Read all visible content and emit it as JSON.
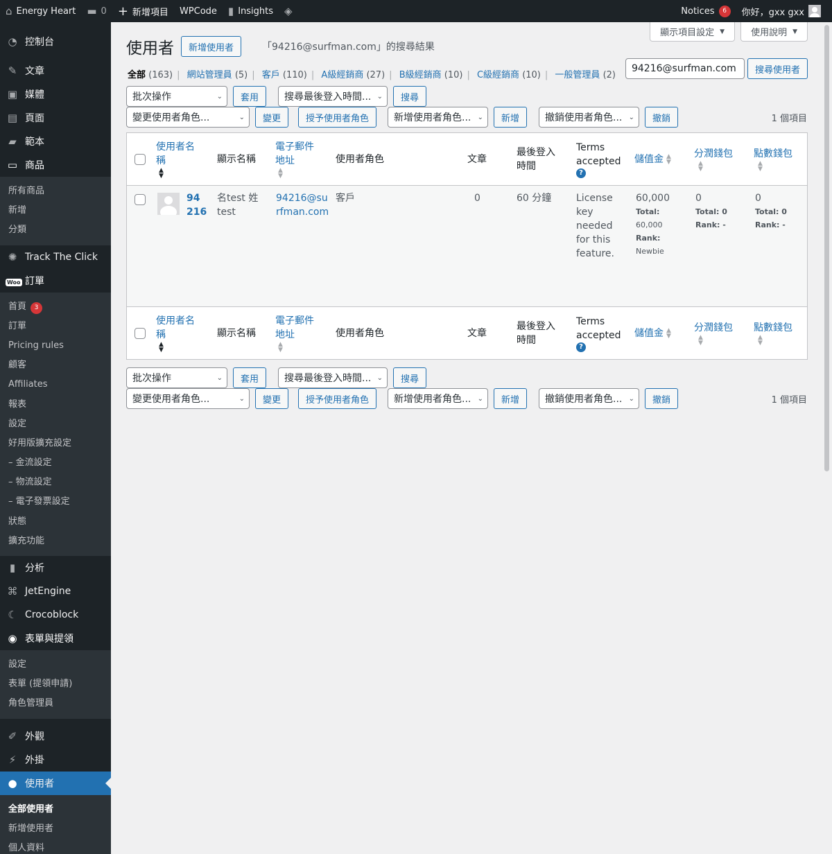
{
  "adminbar": {
    "site_name": "Energy Heart",
    "comments_count": "0",
    "new_item": "新增項目",
    "wpcode": "WPCode",
    "insights": "Insights",
    "notices": "Notices",
    "notices_count": "6",
    "greeting": "你好，gxx gxx"
  },
  "sidebar": {
    "dashboard": "控制台",
    "posts": "文章",
    "media": "媒體",
    "pages": "頁面",
    "templates": "範本",
    "products": "商品",
    "products_sub": [
      "所有商品",
      "新增",
      "分類"
    ],
    "track_click": "Track The Click",
    "orders": "訂單",
    "woo_label": "Woo",
    "orders_sub": {
      "home": "首頁",
      "home_count": "3",
      "items": [
        "訂單",
        "Pricing rules",
        "顧客",
        "Affiliates",
        "報表",
        "設定",
        "好用版擴充設定",
        "– 金流設定",
        "– 物流設定",
        "– 電子發票設定",
        "狀態",
        "擴充功能"
      ]
    },
    "analytics": "分析",
    "jetengine": "JetEngine",
    "crocoblock": "Crocoblock",
    "forms": "表單與提領",
    "forms_sub": [
      "設定",
      "表單 (提領申請)",
      "角色管理員"
    ],
    "appearance": "外觀",
    "plugins": "外掛",
    "users": "使用者",
    "users_sub": [
      "全部使用者",
      "新增使用者",
      "個人資料"
    ]
  },
  "screen_options": {
    "options": "顯示項目設定",
    "help": "使用說明"
  },
  "header": {
    "title": "使用者",
    "add_new": "新增使用者",
    "search_result": "「94216@surfman.com」的搜尋結果"
  },
  "filters": [
    {
      "label": "全部",
      "count": "(163)"
    },
    {
      "label": "網站管理員",
      "count": "(5)"
    },
    {
      "label": "客戶",
      "count": "(110)"
    },
    {
      "label": "A級經銷商",
      "count": "(27)"
    },
    {
      "label": "B級經銷商",
      "count": "(10)"
    },
    {
      "label": "C級經銷商",
      "count": "(10)"
    },
    {
      "label": "一般管理員",
      "count": "(2)"
    }
  ],
  "search": {
    "value": "94216@surfman.com",
    "button": "搜尋使用者"
  },
  "tablenav": {
    "bulk": "批次操作",
    "apply": "套用",
    "last_login": "搜尋最後登入時間...",
    "search": "搜尋",
    "change_role": "變更使用者角色...",
    "change": "變更",
    "grant_role": "授予使用者角色",
    "add_role": "新增使用者角色...",
    "add": "新增",
    "revoke_role": "撤銷使用者角色...",
    "revoke": "撤銷",
    "items_count": "1 個項目"
  },
  "columns": {
    "username": [
      "使用者名",
      "稱"
    ],
    "display_name": "顯示名稱",
    "email": [
      "電子郵件",
      "地址"
    ],
    "role": "使用者角色",
    "posts": "文章",
    "last_login": [
      "最後登入",
      "時間"
    ],
    "terms": [
      "Terms",
      "accepted"
    ],
    "wallet": "儲值金",
    "share_wallet": "分潤錢包",
    "points_wallet": "點數錢包"
  },
  "row": {
    "username": [
      "94",
      "216"
    ],
    "display_name": [
      "名test 姓",
      "test"
    ],
    "email": [
      "94216@su",
      "rfman.com"
    ],
    "role": "客戶",
    "posts": "0",
    "last_login": "60 分鐘",
    "terms": [
      "License",
      "key",
      "needed",
      "for this",
      "feature."
    ],
    "wallet": {
      "value": "60,000",
      "total_label": "Total:",
      "total": "60,000",
      "rank_label": "Rank:",
      "rank": "Newbie"
    },
    "share": {
      "value": "0",
      "total": "Total: 0",
      "rank": "Rank: -"
    },
    "points": {
      "value": "0",
      "total": "Total: 0",
      "rank": "Rank: -"
    }
  }
}
